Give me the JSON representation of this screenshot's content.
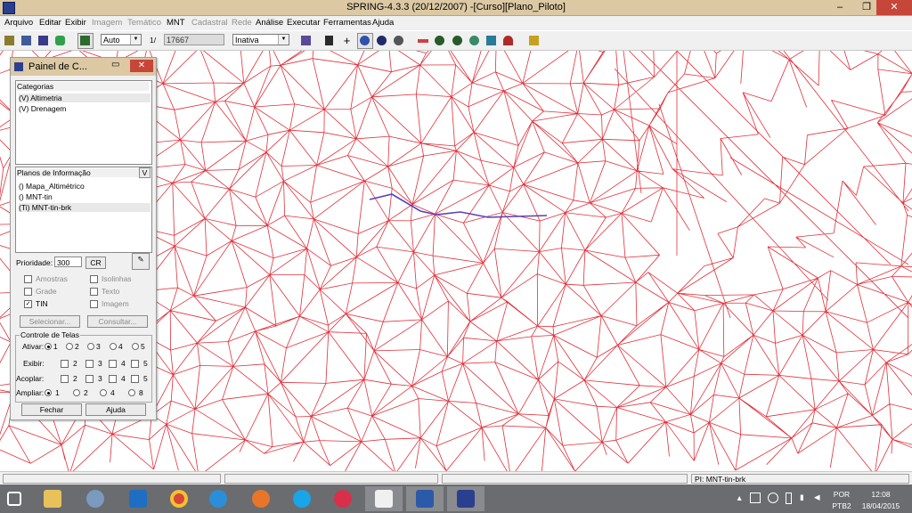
{
  "window": {
    "title": "SPRING-4.3.3 (20/12/2007) -[Curso][Plano_Piloto]"
  },
  "menu": [
    "Arquivo",
    "Editar",
    "Exibir",
    "Imagem",
    "Temático",
    "MNT",
    "Cadastral",
    "Rede",
    "Análise",
    "Executar",
    "Ferramentas",
    "Ajuda"
  ],
  "menu_disabled": [
    "Imagem",
    "Temático",
    "Cadastral",
    "Rede"
  ],
  "toolbar": {
    "zoom_mode": "Auto",
    "scale_prefix": "1/",
    "scale_value": "17667",
    "cursor_mode": "Inativa"
  },
  "panel": {
    "title": "Painel de C...",
    "categories_label": "Categorias",
    "categories": [
      "(V) Altimetria",
      "(V) Drenagem"
    ],
    "planos_label": "Planos de Informação",
    "planos_button": "V",
    "planos": [
      "() Mapa_Altimétrico",
      "() MNT-tin",
      "(Ti) MNT-tin-brk"
    ],
    "prioridade_label": "Prioridade:",
    "prioridade_value": "300",
    "cr_button": "CR",
    "checks": [
      {
        "label": "Amostras",
        "checked": false,
        "enabled": false
      },
      {
        "label": "Isolinhas",
        "checked": false,
        "enabled": false
      },
      {
        "label": "Grade",
        "checked": false,
        "enabled": false
      },
      {
        "label": "Texto",
        "checked": false,
        "enabled": false
      },
      {
        "label": "TIN",
        "checked": true,
        "enabled": true
      },
      {
        "label": "Imagem",
        "checked": false,
        "enabled": false
      }
    ],
    "selecionar_button": "Selecionar...",
    "consultar_button": "Consultar...",
    "controle_label": "Controle de Telas",
    "ativar_label": "Ativar:",
    "exibir_label": "Exibir:",
    "acoplar_label": "Acoplar:",
    "ampliar_label": "Ampliar:",
    "ativar_options": [
      "1",
      "2",
      "3",
      "4",
      "5"
    ],
    "exibir_options": [
      "2",
      "3",
      "4",
      "5"
    ],
    "acoplar_options": [
      "2",
      "3",
      "4",
      "5"
    ],
    "ampliar_options": [
      "1",
      "2",
      "4",
      "8"
    ],
    "fechar_button": "Fechar",
    "ajuda_button": "Ajuda"
  },
  "status": {
    "plano": "PI: MNT-tin-brk"
  },
  "taskbar": {
    "lang": "POR",
    "lang2": "PTB2",
    "time": "12:08",
    "date": "18/04/2015"
  },
  "colors": {
    "tin": "#e0303a",
    "breakline": "#5a3fb8",
    "titlebar": "#dcc9a4"
  }
}
